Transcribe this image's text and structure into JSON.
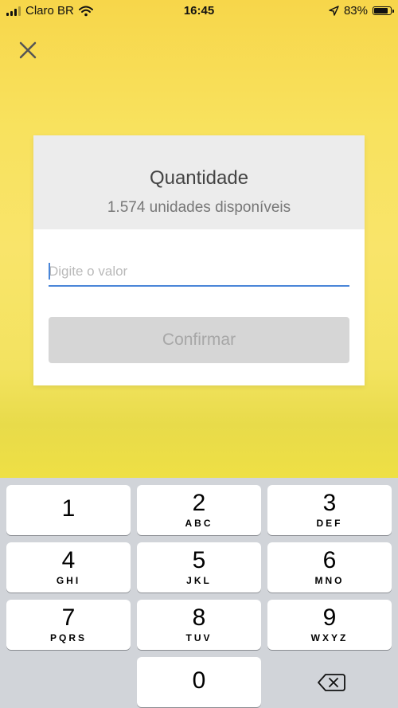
{
  "status_bar": {
    "carrier": "Claro BR",
    "time": "16:45",
    "battery": "83%",
    "battery_level": 0.83,
    "icons": [
      "signal-icon",
      "wifi-icon",
      "location-arrow-icon",
      "battery-icon"
    ]
  },
  "header": {
    "close_icon": "close-icon"
  },
  "card": {
    "title": "Quantidade",
    "subtitle": "1.574 unidades disponíveis",
    "input_placeholder": "Digite o valor",
    "input_value": "",
    "confirm_label": "Confirmar"
  },
  "keypad": {
    "keys": [
      {
        "digit": "1",
        "letters": ""
      },
      {
        "digit": "2",
        "letters": "ABC"
      },
      {
        "digit": "3",
        "letters": "DEF"
      },
      {
        "digit": "4",
        "letters": "GHI"
      },
      {
        "digit": "5",
        "letters": "JKL"
      },
      {
        "digit": "6",
        "letters": "MNO"
      },
      {
        "digit": "7",
        "letters": "PQRS"
      },
      {
        "digit": "8",
        "letters": "TUV"
      },
      {
        "digit": "9",
        "letters": "WXYZ"
      },
      {
        "digit": "0",
        "letters": ""
      }
    ],
    "delete_icon": "backspace-icon"
  },
  "colors": {
    "background_yellow": "#f8e25e",
    "input_underline": "#4a86d8",
    "button_disabled": "#d6d6d6",
    "keypad_background": "#d1d4d9"
  }
}
